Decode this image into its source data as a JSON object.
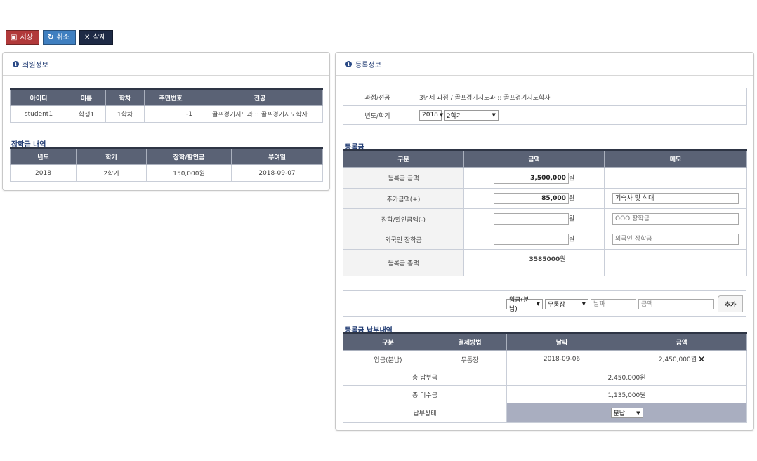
{
  "toolbar": {
    "save_label": "저장",
    "cancel_label": "취소",
    "delete_label": "삭제"
  },
  "member_panel": {
    "title": "회원정보",
    "headers": [
      "아이디",
      "이름",
      "학차",
      "주민번호",
      "전공"
    ],
    "row": [
      "student1",
      "학생1",
      "1학차",
      "-1",
      "골프경기지도과 :: 골프경기지도학사"
    ],
    "scholarship_title": "장학금 내역",
    "scholarship_headers": [
      "년도",
      "학기",
      "장학/할인금",
      "부여일"
    ],
    "scholarship_row": [
      "2018",
      "2학기",
      "150,000원",
      "2018-09-07"
    ]
  },
  "register_panel": {
    "title": "등록정보",
    "course_label": "과정/전공",
    "course_value": "3년제 과정 / 골프경기지도과 :: 골프경기지도학사",
    "term_label": "년도/학기",
    "year_select": "2018",
    "semester_select": "2학기",
    "fee_title": "등록금",
    "fee_headers": [
      "구분",
      "금액",
      "메모"
    ],
    "fee_rows": [
      {
        "label": "등록금 금액",
        "amount": "3,500,000",
        "unit": "원",
        "memo": "",
        "memo_placeholder": ""
      },
      {
        "label": "추가금액(+)",
        "amount": "85,000",
        "unit": "원",
        "memo": "기숙사 및 식대",
        "memo_placeholder": ""
      },
      {
        "label": "장학/할인금액(-)",
        "amount": "",
        "unit": "원",
        "memo": "",
        "memo_placeholder": "OOO 장학금"
      },
      {
        "label": "외국인 장학금",
        "amount": "",
        "unit": "원",
        "memo": "",
        "memo_placeholder": "외국인 장학금"
      }
    ],
    "fee_total_label": "등록금 총액",
    "fee_total_value": "3585000",
    "fee_total_unit": "원",
    "add_bar": {
      "type_select": "입금(분납)",
      "method_select": "무통장",
      "date_placeholder": "날짜",
      "amount_placeholder": "금액",
      "add_label": "추가"
    },
    "payment_title": "등록금 납부내역",
    "payment_headers": [
      "구분",
      "결제방법",
      "날짜",
      "금액"
    ],
    "payment_row": [
      "입금(분납)",
      "무통장",
      "2018-09-06",
      "2,450,000원"
    ],
    "total_paid_label": "총 납부금",
    "total_paid_value": "2,450,000원",
    "total_unpaid_label": "총 미수금",
    "total_unpaid_value": "1,135,000원",
    "status_label": "납부상태",
    "status_select": "분납"
  }
}
